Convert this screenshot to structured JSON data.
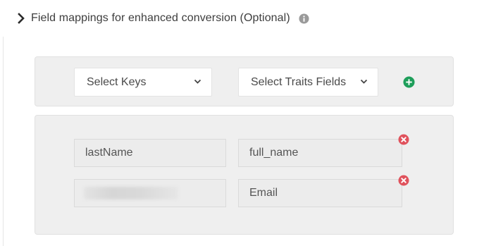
{
  "section": {
    "title": "Field mappings for enhanced conversion (Optional)",
    "expand_icon": "chevron-right-icon",
    "info_icon": "info-icon"
  },
  "selector_row": {
    "keys_select": {
      "selected": "Select Keys",
      "options": [
        "Select Keys"
      ]
    },
    "traits_select": {
      "selected": "Select Traits Fields",
      "options": [
        "Select Traits Fields"
      ]
    },
    "add_icon": "plus-circle-icon",
    "accent_color": "#1e9e5a"
  },
  "mappings": [
    {
      "key": "lastName",
      "value": "full_name",
      "key_redacted": false
    },
    {
      "key": "",
      "value": "Email",
      "key_redacted": true
    }
  ],
  "remove_icon": "x-circle-icon",
  "remove_color": "#e0525c"
}
